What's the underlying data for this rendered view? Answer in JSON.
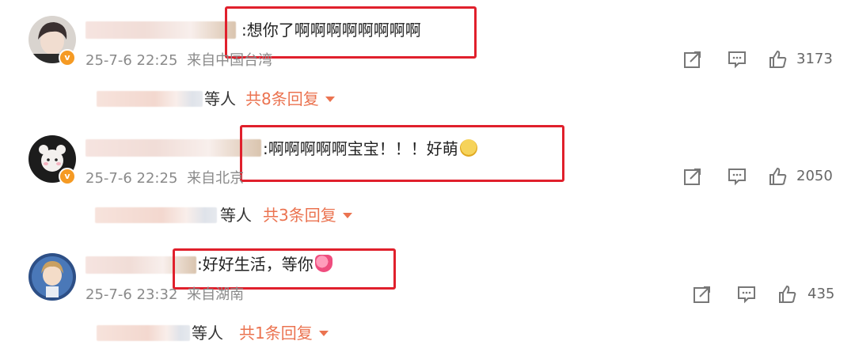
{
  "colors": {
    "accent": "#eb7350",
    "highlight_box": "#e0202c",
    "meta_gray": "#8a8a8a",
    "verified": "#f59a23"
  },
  "icons": {
    "share": "share-icon",
    "comment": "comment-icon",
    "like": "like-icon"
  },
  "comments": [
    {
      "text": ":想你了啊啊啊啊啊啊啊啊",
      "date": "25-7-6 22:25",
      "location": "来自中国台湾",
      "likes": "3173",
      "reply_who": "等人",
      "reply_count": "共8条回复"
    },
    {
      "text": ":啊啊啊啊啊宝宝！！！好萌",
      "date": "25-7-6 22:25",
      "location": "来自北京",
      "likes": "2050",
      "reply_who": "等人",
      "reply_count": "共3条回复"
    },
    {
      "text": ":好好生活，等你",
      "date": "25-7-6 23:32",
      "location": "来自湖南",
      "likes": "435",
      "reply_who": "等人",
      "reply_count": "共1条回复"
    }
  ]
}
